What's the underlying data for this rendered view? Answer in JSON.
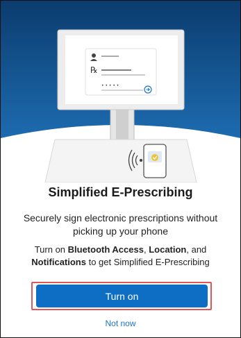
{
  "colors": {
    "hero_blue_dark": "#0b3c6e",
    "hero_blue_light": "#1d6bb0",
    "primary_button": "#0d6ec4",
    "link": "#1a73c8",
    "highlight_border": "#e0555a"
  },
  "illustration": {
    "icons": [
      "user-icon",
      "prescription-rx-icon",
      "password-dots-icon",
      "submit-arrow-icon",
      "wireless-signal-icon",
      "phone-check-icon"
    ],
    "rx_symbol": "℞",
    "password_mask": "• • • • •"
  },
  "content": {
    "title": "Simplified E-Prescribing",
    "subtitle": "Securely sign electronic prescriptions without picking up your phone",
    "instructions": {
      "prefix": "Turn on ",
      "bluetooth": "Bluetooth Access",
      "sep1": ", ",
      "location": "Location",
      "sep2": ", and ",
      "notifications": "Notifications",
      "suffix": " to get Simplified E-Prescribing"
    }
  },
  "actions": {
    "turn_on": "Turn on",
    "not_now": "Not now"
  }
}
